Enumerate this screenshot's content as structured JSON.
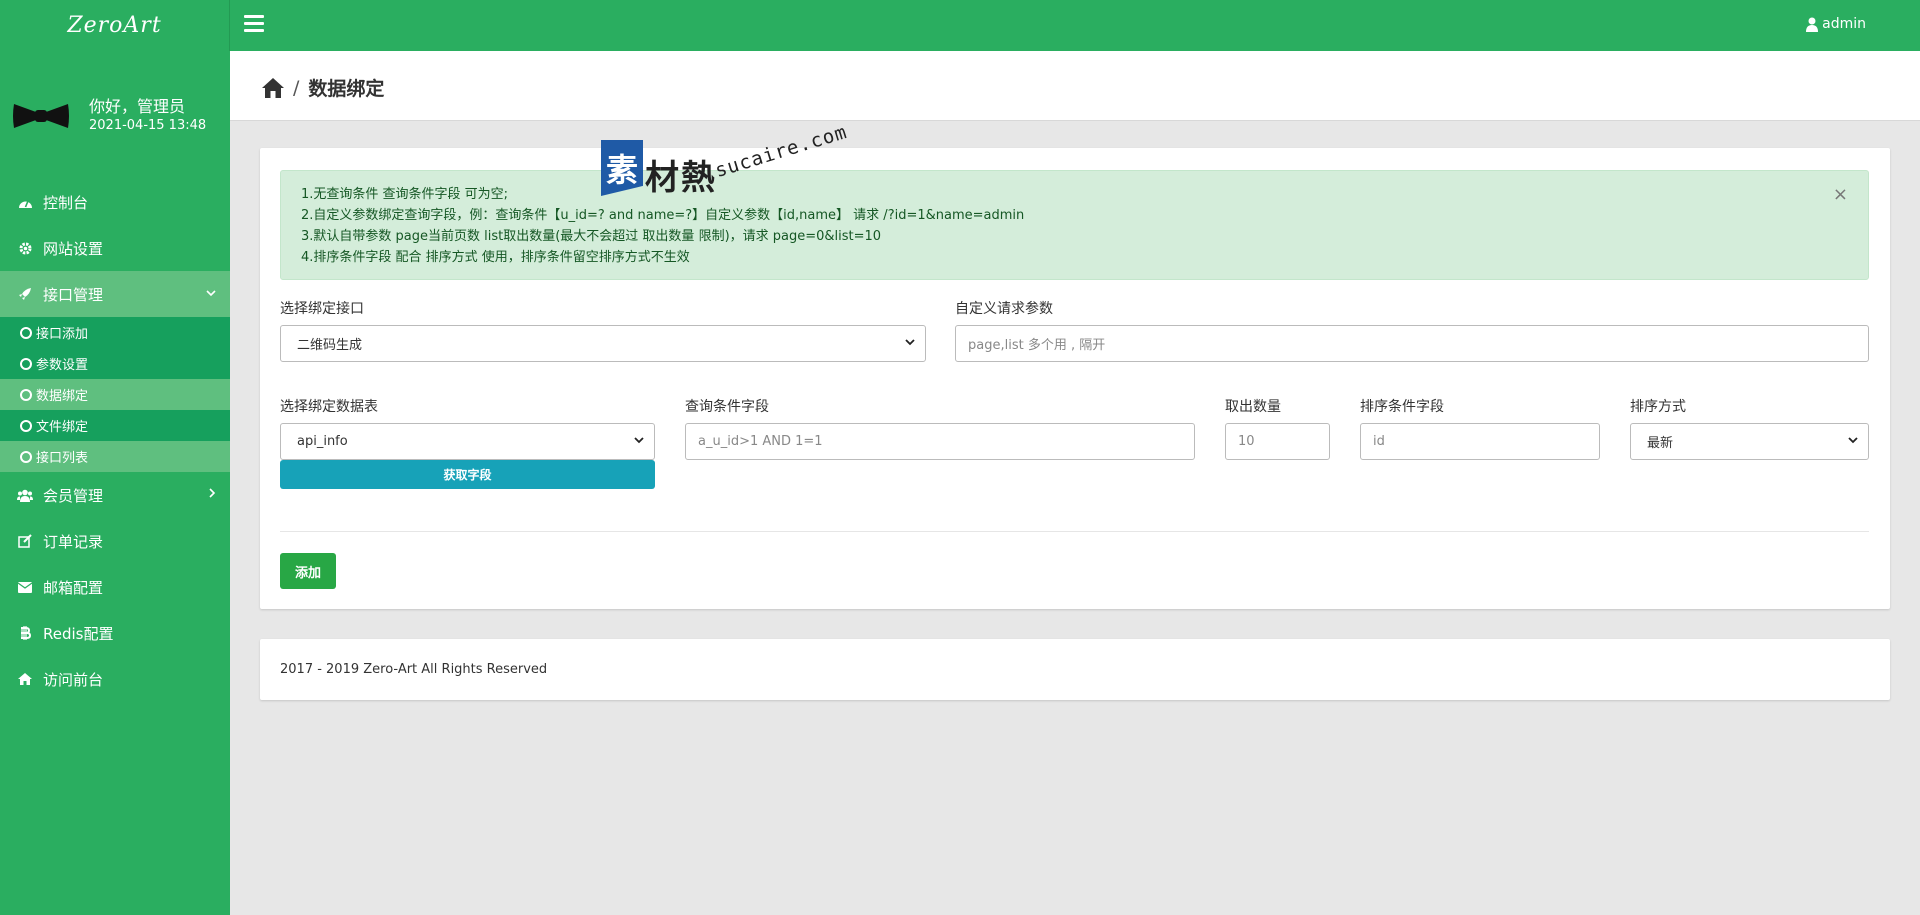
{
  "app": {
    "logo": "ZeroArt",
    "user": "admin"
  },
  "profile": {
    "greeting": "你好，管理员",
    "time": "2021-04-15 13:48"
  },
  "sidebar": {
    "items": [
      {
        "label": "控制台",
        "icon": "dashboard-icon"
      },
      {
        "label": "网站设置",
        "icon": "gear-icon"
      },
      {
        "label": "接口管理",
        "icon": "rocket-icon",
        "expanded": true
      },
      {
        "label": "会员管理",
        "icon": "users-icon"
      },
      {
        "label": "订单记录",
        "icon": "edit-icon"
      },
      {
        "label": "邮箱配置",
        "icon": "envelope-icon"
      },
      {
        "label": "Redis配置",
        "icon": "bitcoin-icon"
      },
      {
        "label": "访问前台",
        "icon": "home-icon"
      }
    ],
    "submenu": [
      {
        "label": "接口添加"
      },
      {
        "label": "参数设置"
      },
      {
        "label": "数据绑定",
        "active": true
      },
      {
        "label": "文件绑定"
      },
      {
        "label": "接口列表"
      }
    ]
  },
  "header": {
    "title": "数据绑定"
  },
  "alert": {
    "lines": [
      "1.无查询条件 查询条件字段 可为空;",
      "2.自定义参数绑定查询字段，例：查询条件【u_id=? and name=?】自定义参数【id,name】 请求 /?id=1&name=admin",
      "3.默认自带参数 page当前页数 list取出数量(最大不会超过 取出数量 限制)，请求 page=0&list=10",
      "4.排序条件字段 配合 排序方式 使用，排序条件留空排序方式不生效"
    ],
    "close": "×"
  },
  "form": {
    "interface_label": "选择绑定接口",
    "interface_value": "二维码生成",
    "params_label": "自定义请求参数",
    "params_placeholder": "page,list 多个用 , 隔开",
    "table_label": "选择绑定数据表",
    "table_value": "api_info",
    "fetch_button": "获取字段",
    "query_label": "查询条件字段",
    "query_placeholder": "a_u_id>1 AND 1=1",
    "count_label": "取出数量",
    "count_placeholder": "10",
    "sort_field_label": "排序条件字段",
    "sort_field_placeholder": "id",
    "sort_order_label": "排序方式",
    "sort_order_value": "最新",
    "add_button": "添加"
  },
  "footer": {
    "text": "2017 - 2019 Zero-Art All Rights Reserved"
  },
  "watermark": {
    "logo_char": "素",
    "chars": "材熱",
    "url": "sucaire.com"
  },
  "colors": {
    "primary": "#2aae60",
    "info": "#17a2b8",
    "success": "#28a745",
    "alert_bg": "#d4edda"
  }
}
